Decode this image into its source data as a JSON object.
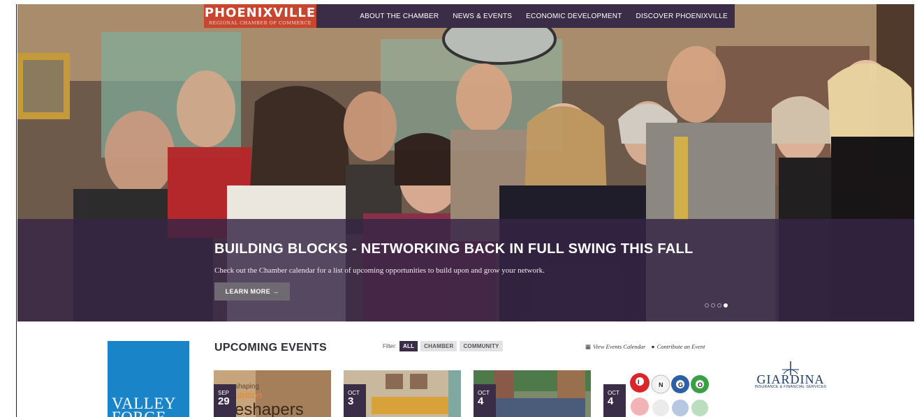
{
  "logo": {
    "name": "PHOENIXVILLE",
    "sub": "REGIONAL CHAMBER OF COMMERCE"
  },
  "nav": [
    "ABOUT THE CHAMBER",
    "NEWS & EVENTS",
    "ECONOMIC DEVELOPMENT",
    "DISCOVER PHOENIXVILLE"
  ],
  "hero": {
    "title": "BUILDING BLOCKS - NETWORKING BACK IN FULL SWING THIS FALL",
    "text": "Check out the Chamber calendar for a list of upcoming opportunities to build upon and grow your network.",
    "button": "LEARN MORE →",
    "slides_total": 4,
    "slide_active": 4
  },
  "events": {
    "title": "UPCOMING EVENTS",
    "filter_label": "Filter:",
    "filters": [
      "ALL",
      "CHAMBER",
      "COMMUNITY"
    ],
    "view_calendar": "View Events Calendar",
    "contribute": "Contribute an Event",
    "cards": [
      {
        "month": "SEP",
        "day": "29",
        "image_text": "eshapers",
        "image_small": "shaping",
        "image_small2": "utrition"
      },
      {
        "month": "OCT",
        "day": "3"
      },
      {
        "month": "OCT",
        "day": "4"
      },
      {
        "month": "OCT",
        "day": "4",
        "bingo": [
          "I",
          "N",
          "G",
          "O"
        ]
      }
    ]
  },
  "sponsors": {
    "left_text": "VALLEY FORGE",
    "right_name": "GIARDINA",
    "right_sub": "INSURANCE & FINANCIAL SERVICES"
  },
  "colors": {
    "brand_red": "#c8452f",
    "brand_purple": "#3b2d48",
    "sponsor_blue": "#1a84c9"
  }
}
